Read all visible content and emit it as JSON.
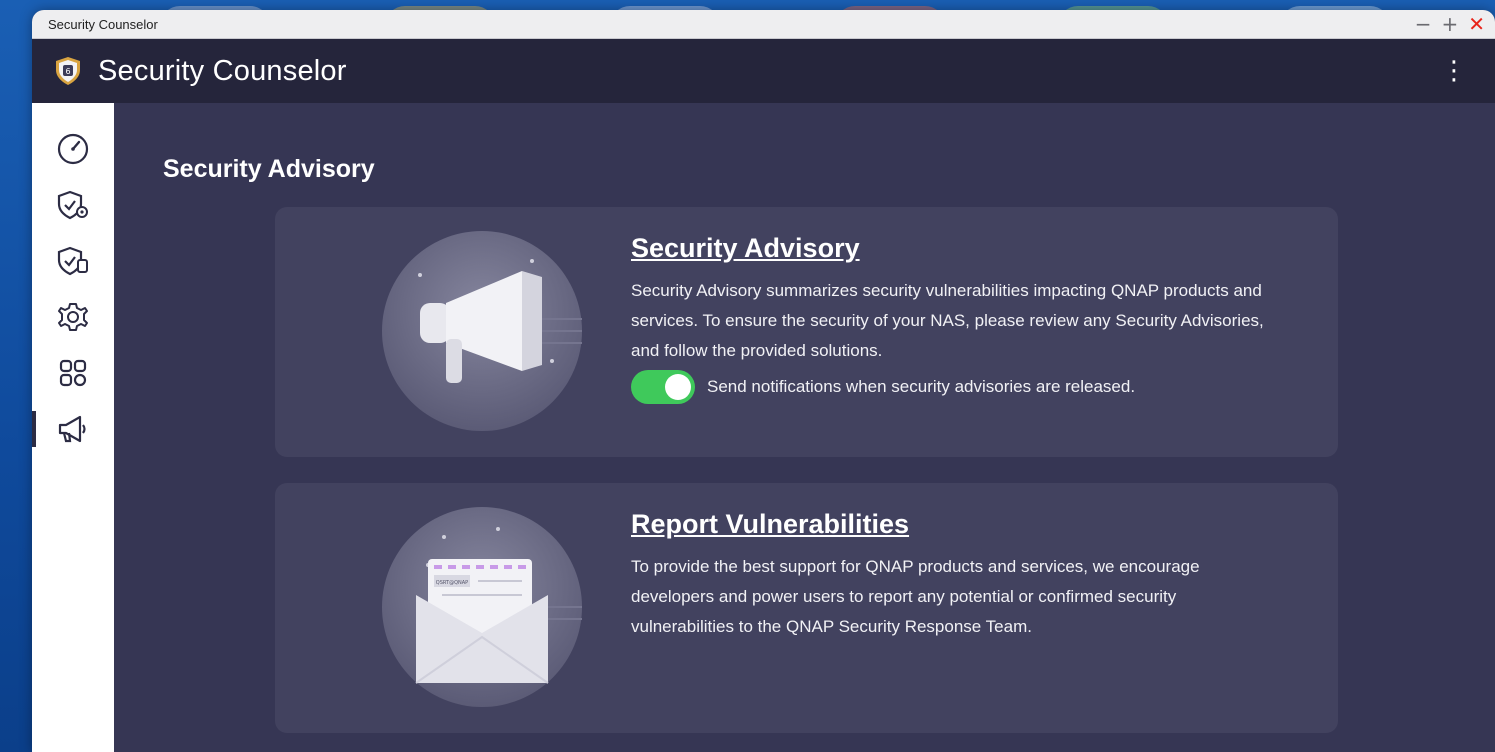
{
  "window": {
    "title": "Security Counselor",
    "controls": {
      "minimize": "−",
      "maximize": "+",
      "close": "✕"
    }
  },
  "header": {
    "app_title": "Security Counselor",
    "logo_icon": "shield-badge-icon",
    "menu_icon": "more-vertical-icon",
    "menu_glyph": "⋮"
  },
  "sidebar": {
    "items": [
      {
        "name": "overview",
        "icon": "speedometer-icon",
        "active": false
      },
      {
        "name": "security-checkup",
        "icon": "shield-gear-icon",
        "active": false
      },
      {
        "name": "security-protection",
        "icon": "shield-device-icon",
        "active": false
      },
      {
        "name": "settings",
        "icon": "gear-icon",
        "active": false
      },
      {
        "name": "apps",
        "icon": "apps-grid-icon",
        "active": false
      },
      {
        "name": "security-advisory",
        "icon": "megaphone-icon",
        "active": true
      }
    ]
  },
  "main": {
    "section_title": "Security Advisory",
    "cards": [
      {
        "title": "Security Advisory",
        "description": "Security Advisory summarizes security vulnerabilities impacting QNAP products and services. To ensure the security of your NAS, please review any Security Advisories, and follow the provided solutions.",
        "illustration": "megaphone-illustration",
        "toggle": {
          "on": true,
          "label": "Send notifications when security advisories are released."
        }
      },
      {
        "title": "Report Vulnerabilities",
        "description": "To provide the best support for QNAP products and services, we encourage developers and power users to report any potential or confirmed security vulnerabilities to the QNAP Security Response Team.",
        "illustration": "envelope-illustration",
        "envelope_text": "QSRT@QNAP"
      }
    ]
  },
  "colors": {
    "header_bg": "#25253b",
    "content_bg": "#363654",
    "card_bg": "#42425f",
    "toggle_on": "#3fc95b",
    "close_red": "#e8241b"
  }
}
